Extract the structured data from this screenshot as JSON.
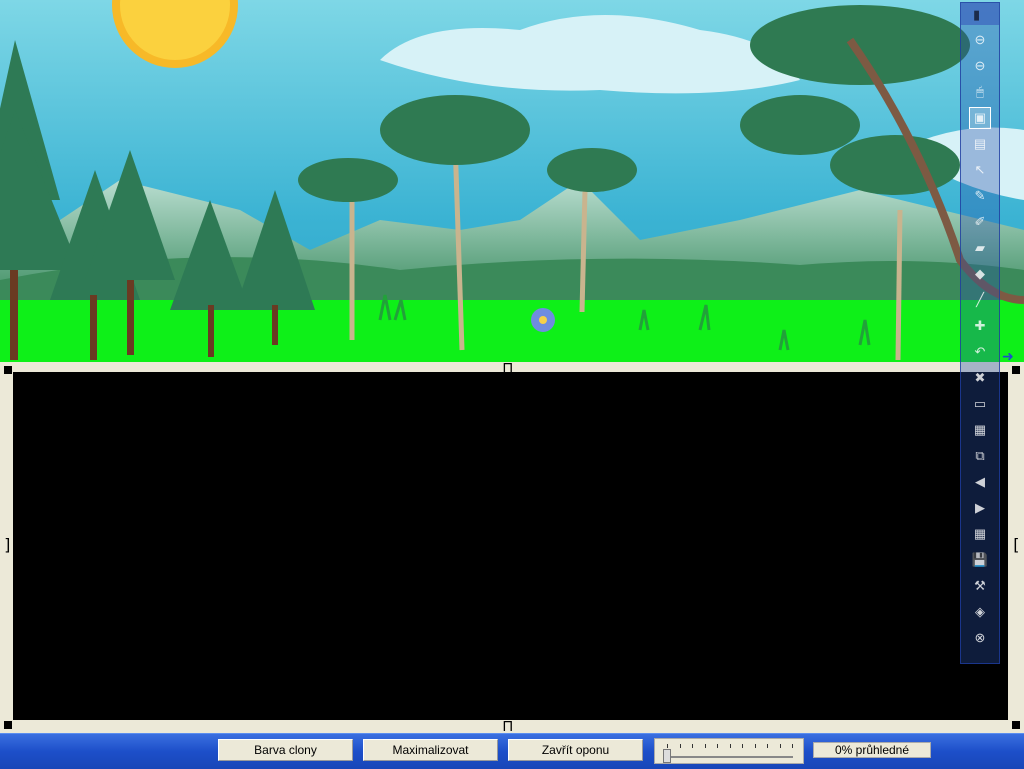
{
  "bottom_bar": {
    "curtain_color_label": "Barva clony",
    "maximize_label": "Maximalizovat",
    "close_curtain_label": "Zavřít oponu",
    "opacity_label": "0% průhledné",
    "opacity_value": 0
  },
  "toolbar": {
    "items": [
      {
        "icon": "circle-up-icon",
        "glyph": "⊖"
      },
      {
        "icon": "circle-down-icon",
        "glyph": "⊖"
      },
      {
        "icon": "mouse-icon",
        "glyph": "🖱"
      },
      {
        "icon": "page-copy-icon",
        "glyph": "▣"
      },
      {
        "icon": "screen-shade-icon",
        "glyph": "▤"
      },
      {
        "icon": "select-arrow-icon",
        "glyph": "↖"
      },
      {
        "icon": "pen-icon",
        "glyph": "✎"
      },
      {
        "icon": "highlighter-icon",
        "glyph": "✐"
      },
      {
        "icon": "eraser-icon",
        "glyph": "▰"
      },
      {
        "icon": "shapes-icon",
        "glyph": "◆"
      },
      {
        "icon": "line-icon",
        "glyph": "╱"
      },
      {
        "icon": "add-icon",
        "glyph": "✚"
      },
      {
        "icon": "undo-icon",
        "glyph": "↶"
      },
      {
        "icon": "delete-icon",
        "glyph": "✖"
      },
      {
        "icon": "new-page-icon",
        "glyph": "▭"
      },
      {
        "icon": "page-icon",
        "glyph": "▦"
      },
      {
        "icon": "duplicate-icon",
        "glyph": "⧉"
      },
      {
        "icon": "back-arrow-icon",
        "glyph": "◀"
      },
      {
        "icon": "forward-arrow-icon",
        "glyph": "▶"
      },
      {
        "icon": "table-icon",
        "glyph": "▦"
      },
      {
        "icon": "save-icon",
        "glyph": "💾"
      },
      {
        "icon": "tools-icon",
        "glyph": "⚒"
      },
      {
        "icon": "eraser-tool-icon",
        "glyph": "◈"
      },
      {
        "icon": "close-icon",
        "glyph": "⊗"
      }
    ],
    "active_index": 3
  }
}
